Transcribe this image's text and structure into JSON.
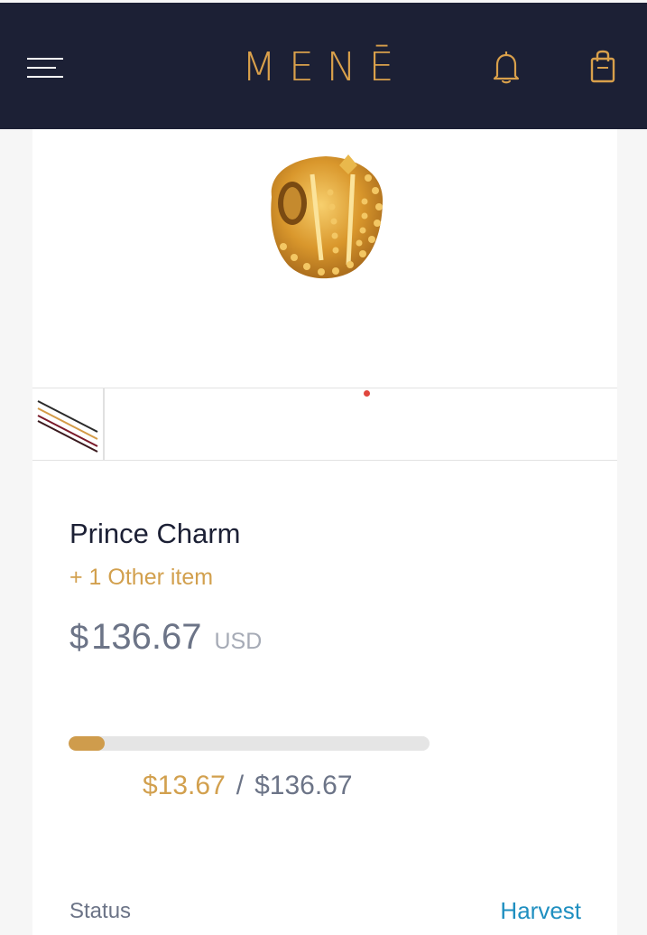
{
  "header": {
    "brand": "MENĒ",
    "menu_icon": "hamburger-menu-icon",
    "bell_icon": "bell-icon",
    "bag_icon": "shopping-bag-icon",
    "background": "#1c2035",
    "accent": "#d9a04b"
  },
  "product": {
    "image_icon": "gold-crown-charm",
    "title": "Prince Charm",
    "other_items": "+ 1 Other item",
    "currency_symbol": "$",
    "price": "136.67",
    "currency": "USD"
  },
  "funding": {
    "raised": "$13.67",
    "separator": "/",
    "goal": "$136.67",
    "progress_fraction": 0.1,
    "fill_color": "#cf9c4c"
  },
  "details": {
    "status_label": "Status",
    "status_value": "Harvest",
    "status_color": "#1f8fc0"
  }
}
